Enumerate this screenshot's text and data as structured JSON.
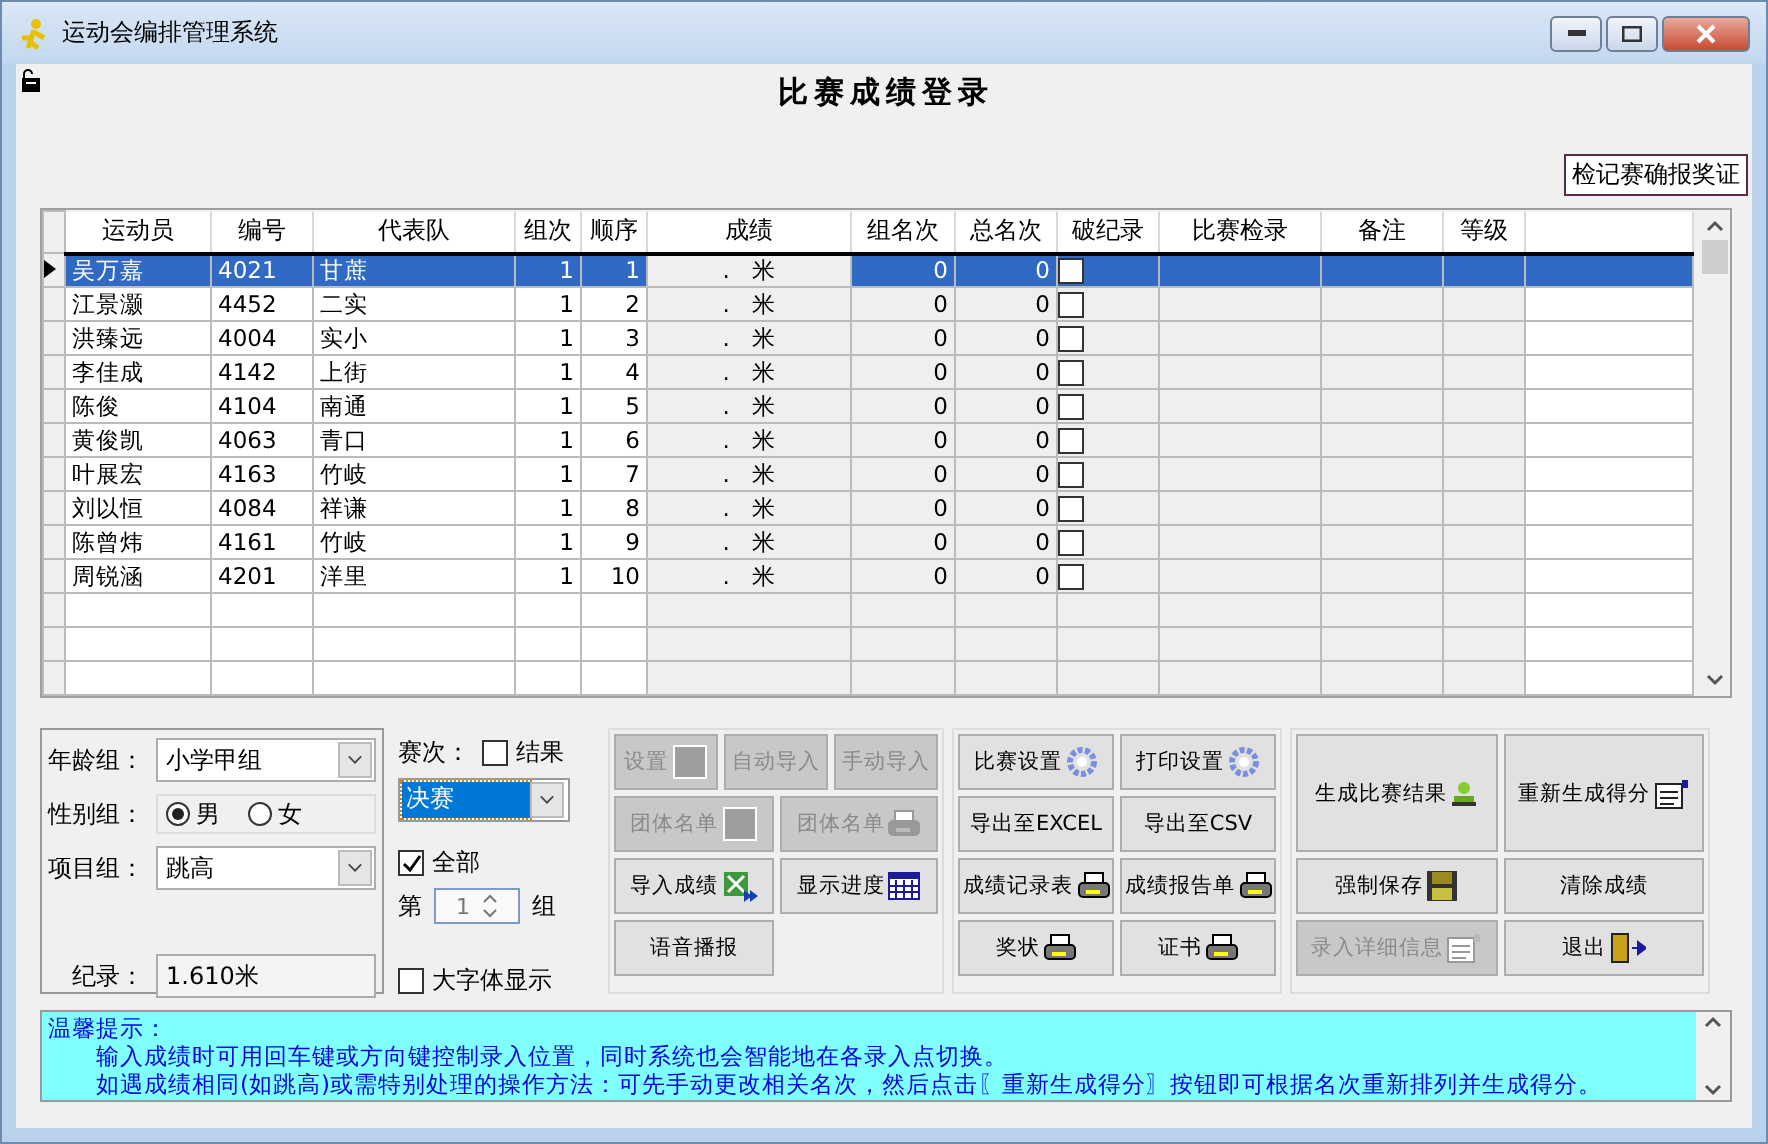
{
  "window": {
    "title": "运动会编排管理系统"
  },
  "heading": "比赛成绩登录",
  "top_button": "检记赛确报奖证",
  "table": {
    "columns": [
      "运动员",
      "编号",
      "代表队",
      "组次",
      "顺序",
      "成绩",
      "组名次",
      "总名次",
      "破纪录",
      "比赛检录",
      "备注",
      "等级"
    ],
    "rows": [
      {
        "selected": true,
        "athlete": "吴万嘉",
        "number": "4021",
        "team": "甘蔗",
        "group": "1",
        "order": "1",
        "score": ".   米",
        "group_rank": "0",
        "overall_rank": "0",
        "record_broken": false
      },
      {
        "selected": false,
        "athlete": "江景灏",
        "number": "4452",
        "team": "二实",
        "group": "1",
        "order": "2",
        "score": ".   米",
        "group_rank": "0",
        "overall_rank": "0",
        "record_broken": false
      },
      {
        "selected": false,
        "athlete": "洪臻远",
        "number": "4004",
        "team": "实小",
        "group": "1",
        "order": "3",
        "score": ".   米",
        "group_rank": "0",
        "overall_rank": "0",
        "record_broken": false
      },
      {
        "selected": false,
        "athlete": "李佳成",
        "number": "4142",
        "team": "上街",
        "group": "1",
        "order": "4",
        "score": ".   米",
        "group_rank": "0",
        "overall_rank": "0",
        "record_broken": false
      },
      {
        "selected": false,
        "athlete": "陈俊",
        "number": "4104",
        "team": "南通",
        "group": "1",
        "order": "5",
        "score": ".   米",
        "group_rank": "0",
        "overall_rank": "0",
        "record_broken": false
      },
      {
        "selected": false,
        "athlete": "黄俊凯",
        "number": "4063",
        "team": "青口",
        "group": "1",
        "order": "6",
        "score": ".   米",
        "group_rank": "0",
        "overall_rank": "0",
        "record_broken": false
      },
      {
        "selected": false,
        "athlete": "叶展宏",
        "number": "4163",
        "team": "竹岐",
        "group": "1",
        "order": "7",
        "score": ".   米",
        "group_rank": "0",
        "overall_rank": "0",
        "record_broken": false
      },
      {
        "selected": false,
        "athlete": "刘以恒",
        "number": "4084",
        "team": "祥谦",
        "group": "1",
        "order": "8",
        "score": ".   米",
        "group_rank": "0",
        "overall_rank": "0",
        "record_broken": false
      },
      {
        "selected": false,
        "athlete": "陈曾炜",
        "number": "4161",
        "team": "竹岐",
        "group": "1",
        "order": "9",
        "score": ".   米",
        "group_rank": "0",
        "overall_rank": "0",
        "record_broken": false
      },
      {
        "selected": false,
        "athlete": "周锐涵",
        "number": "4201",
        "team": "洋里",
        "group": "1",
        "order": "10",
        "score": ".   米",
        "group_rank": "0",
        "overall_rank": "0",
        "record_broken": false
      }
    ]
  },
  "filters": {
    "age_label": "年龄组：",
    "age_value": "小学甲组",
    "gender_label": "性别组：",
    "genders": [
      {
        "label": "男",
        "selected": true
      },
      {
        "label": "女",
        "selected": false
      }
    ],
    "event_label": "项目组：",
    "event_value": "跳高",
    "record_label": "纪录：",
    "record_value": "1.610米"
  },
  "round": {
    "label": "赛次：",
    "result": {
      "label": "结果",
      "checked": false
    },
    "value": "决赛",
    "all": {
      "label": "全部",
      "checked": true
    },
    "group_prefix": "第",
    "group_value": "1",
    "group_suffix": "组",
    "large_font": {
      "label": "大字体显示",
      "checked": false
    }
  },
  "button_panels": [
    [
      {
        "label": "设置",
        "disabled": true
      },
      {
        "label": "自动导入",
        "disabled": true
      },
      {
        "label": "手动导入",
        "disabled": true
      },
      {
        "label": "团体名单",
        "disabled": true
      },
      {
        "label": "团体名单",
        "disabled": true
      },
      {
        "label": "导入成绩",
        "disabled": false
      },
      {
        "label": "显示进度",
        "disabled": false
      },
      {
        "label": "语音播报",
        "disabled": false
      }
    ],
    [
      {
        "label": "比赛设置",
        "disabled": false
      },
      {
        "label": "打印设置",
        "disabled": false
      },
      {
        "label": "导出至EXCEL",
        "disabled": false
      },
      {
        "label": "导出至CSV",
        "disabled": false
      },
      {
        "label": "成绩记录表",
        "disabled": false
      },
      {
        "label": "成绩报告单",
        "disabled": false
      },
      {
        "label": "奖状",
        "disabled": false
      },
      {
        "label": "证书",
        "disabled": false
      }
    ],
    [
      {
        "label": "生成比赛结果",
        "disabled": false
      },
      {
        "label": "重新生成得分",
        "disabled": false
      },
      {
        "label": "强制保存",
        "disabled": false
      },
      {
        "label": "清除成绩",
        "disabled": false
      },
      {
        "label": "录入详细信息",
        "disabled": true
      },
      {
        "label": "退出",
        "disabled": false
      }
    ]
  ],
  "tips": {
    "title": "温馨提示：",
    "lines": [
      "输入成绩时可用回车键或方向键控制录入位置，同时系统也会智能地在各录入点切换。",
      "如遇成绩相同(如跳高)或需特别处理的操作方法：可先手动更改相关名次，然后点击〖重新生成得分〗按钮即可根据名次重新排列并生成得分。"
    ]
  }
}
